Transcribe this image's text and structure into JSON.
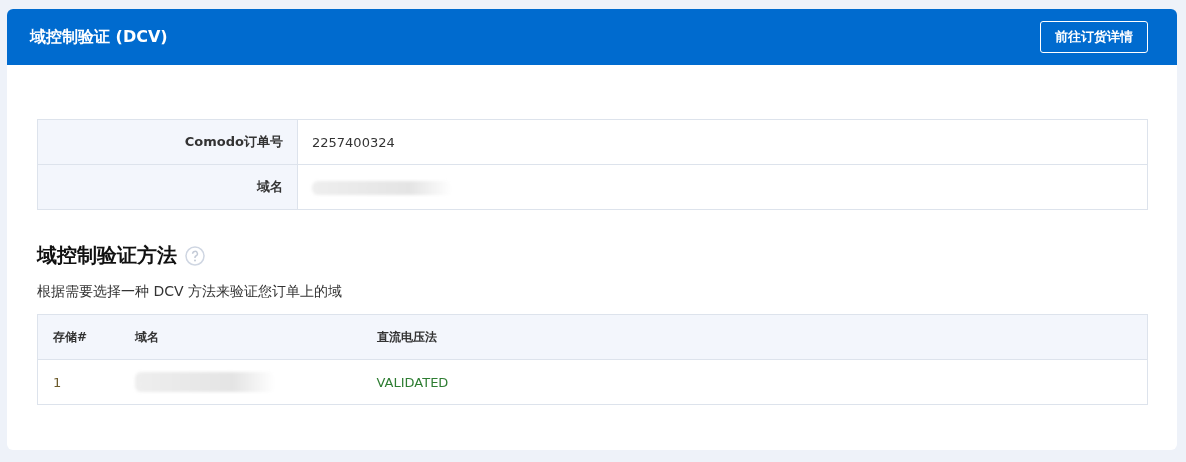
{
  "header": {
    "title": "域控制验证 (DCV)",
    "button": "前往订货详情"
  },
  "order_info": [
    {
      "label": "Comodo订单号",
      "kind": "text",
      "value": "2257400324"
    },
    {
      "label": "域名",
      "kind": "redacted"
    }
  ],
  "section": {
    "title": "域控制验证方法",
    "description": "根据需要选择一种 DCV 方法来验证您订单上的域"
  },
  "table": {
    "columns": [
      "存储#",
      "域名",
      "直流电压法"
    ],
    "rows": [
      {
        "cells": [
          {
            "kind": "text",
            "value": "1"
          },
          {
            "kind": "redacted"
          },
          {
            "kind": "status",
            "value": "VALIDATED"
          }
        ]
      }
    ]
  }
}
